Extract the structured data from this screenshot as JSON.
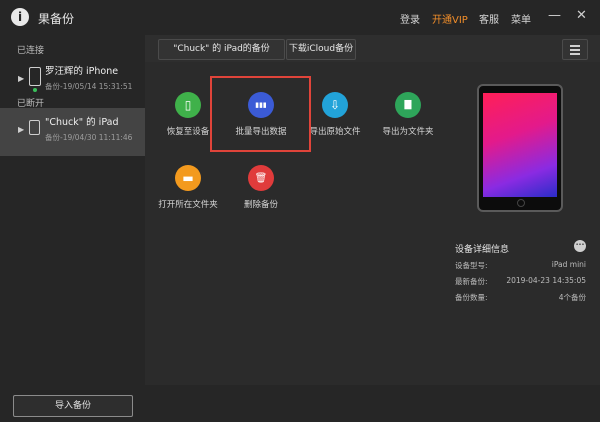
{
  "app": {
    "title": "果备份",
    "logo_glyph": "i"
  },
  "topnav": {
    "login": "登录",
    "vip": "开通VIP",
    "support": "客服",
    "menu": "菜单",
    "vip_color": "#f08d2a"
  },
  "window": {
    "minimize": "—",
    "close": "✕"
  },
  "sidebar": {
    "connected_label": "已连接",
    "disconnected_label": "已断开",
    "devices": [
      {
        "name": "罗汪辉的 iPhone",
        "sub": "备份-19/05/14 15:31:51",
        "status": "connected",
        "icon": "iphone-icon"
      },
      {
        "name": "\"Chuck\" 的 iPad",
        "sub": "备份-19/04/30 11:11:46",
        "status": "disconnected",
        "icon": "ipad-icon"
      }
    ],
    "import_button": "导入备份"
  },
  "tabs": [
    {
      "label": "\"Chuck\" 的 iPad的备份"
    },
    {
      "label": "下载iCloud备份"
    }
  ],
  "actions": [
    {
      "label": "恢复至设备",
      "icon": "phone-restore-icon",
      "color": "#3fb14a",
      "glyph": "▯"
    },
    {
      "label": "批量导出数据",
      "icon": "batch-export-icon",
      "color": "#3b5bd6",
      "glyph": "▮▮▮"
    },
    {
      "label": "导出原始文件",
      "icon": "export-raw-icon",
      "color": "#22a3d9",
      "glyph": "⇩"
    },
    {
      "label": "导出为文件夹",
      "icon": "export-folder-icon",
      "color": "#2ea55a",
      "glyph": "▇"
    },
    {
      "label": "打开所在文件夹",
      "icon": "open-folder-icon",
      "color": "#f39a1e",
      "glyph": "▬"
    },
    {
      "label": "删除备份",
      "icon": "delete-icon",
      "color": "#e03b3b",
      "glyph": "🗑"
    }
  ],
  "highlight_color": "#e0443a",
  "device_detail": {
    "title": "设备详细信息",
    "more_glyph": "•••",
    "rows": [
      {
        "label": "设备型号:",
        "value": "iPad mini"
      },
      {
        "label": "最新备份:",
        "value": "2019-04-23 14:35:05"
      },
      {
        "label": "备份数量:",
        "value": "4个备份"
      }
    ]
  }
}
